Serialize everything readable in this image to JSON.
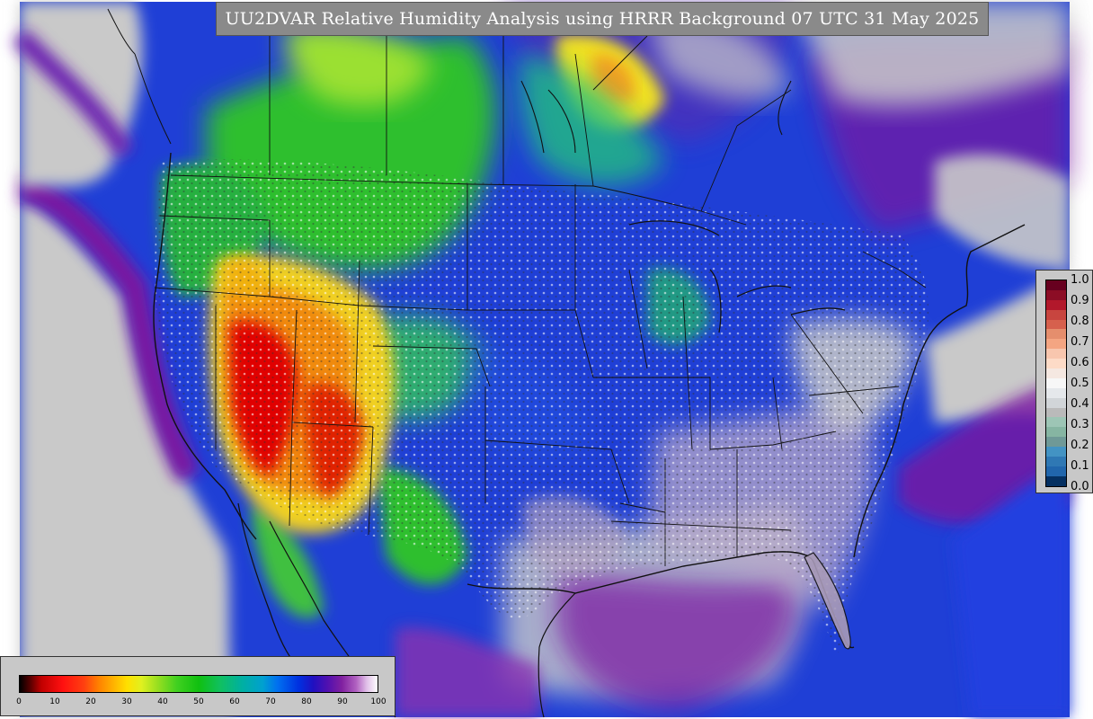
{
  "title": "UU2DVAR Relative Humidity Analysis using HRRR Background 07 UTC 31 May 2025",
  "colorbar_right": {
    "labels": [
      "1.0",
      "0.9",
      "0.8",
      "0.7",
      "0.6",
      "0.5",
      "0.4",
      "0.3",
      "0.2",
      "0.1",
      "0.0"
    ],
    "colors": [
      "#67001f",
      "#8c0d25",
      "#b2182b",
      "#c8453f",
      "#d6604d",
      "#e58e6d",
      "#f4a582",
      "#f8c6ae",
      "#fddbc7",
      "#f5e8e1",
      "#f7f7f7",
      "#e5e8eb",
      "#d1d5d8",
      "#bababa",
      "#9dc5b5",
      "#86b5a2",
      "#6f9997",
      "#4393c3",
      "#2f78b4",
      "#2166ac",
      "#053061"
    ]
  },
  "colorbar_bottom": {
    "ticks": [
      "0",
      "10",
      "20",
      "30",
      "40",
      "50",
      "60",
      "70",
      "80",
      "90",
      "100"
    ]
  },
  "colors": {
    "land_bg": "#1f3fd6",
    "ocean_gray": "#c9c9c9",
    "dry_red": "#e00000",
    "green": "#2fbf2f",
    "purple": "#7a18a0"
  }
}
